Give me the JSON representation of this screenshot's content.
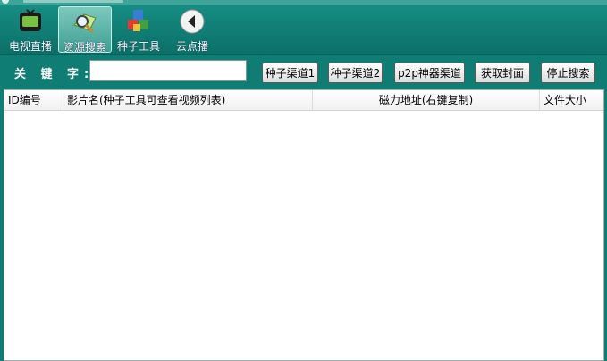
{
  "toolbar": {
    "items": [
      {
        "label": "电视直播",
        "icon": "tv-icon"
      },
      {
        "label": "资源搜索",
        "icon": "magnifier-icon"
      },
      {
        "label": "种子工具",
        "icon": "cubes-icon"
      },
      {
        "label": "云点播",
        "icon": "play-back-icon"
      }
    ],
    "active_index": 1
  },
  "search": {
    "label": "关 键 字:",
    "value": "",
    "buttons": {
      "channel1": "种子渠道1",
      "channel2": "种子渠道2",
      "p2p": "p2p神器渠道",
      "cover": "获取封面",
      "stop": "停止搜索"
    }
  },
  "table": {
    "columns": {
      "id": "ID编号",
      "name": "影片名(种子工具可查看视频列表)",
      "magnet": "磁力地址(右键复制)",
      "size": "文件大小"
    },
    "rows": []
  },
  "colors": {
    "accent": "#0f7d74",
    "toolbar_active": "#5fb5aa"
  }
}
